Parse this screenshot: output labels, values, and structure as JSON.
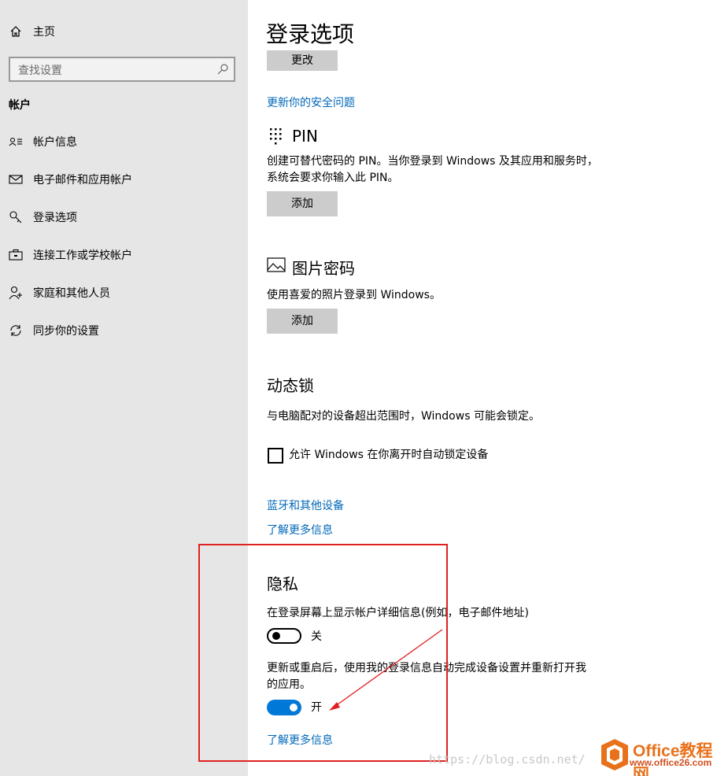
{
  "sidebar": {
    "home_label": "主页",
    "search_placeholder": "查找设置",
    "section_title": "帐户",
    "items": [
      {
        "label": "帐户信息",
        "icon": "account-info-icon"
      },
      {
        "label": "电子邮件和应用帐户",
        "icon": "mail-icon"
      },
      {
        "label": "登录选项",
        "icon": "key-icon"
      },
      {
        "label": "连接工作或学校帐户",
        "icon": "briefcase-icon"
      },
      {
        "label": "家庭和其他人员",
        "icon": "person-add-icon"
      },
      {
        "label": "同步你的设置",
        "icon": "sync-icon"
      }
    ]
  },
  "main": {
    "title": "登录选项",
    "change_button": "更改",
    "update_security_link": "更新你的安全问题",
    "pin": {
      "title": "PIN",
      "desc_line1": "创建可替代密码的 PIN。当你登录到 Windows 及其应用和服务时，",
      "desc_line2": "系统会要求你输入此 PIN。",
      "add_button": "添加"
    },
    "picture_password": {
      "title": "图片密码",
      "desc": "使用喜爱的照片登录到 Windows。",
      "add_button": "添加"
    },
    "dynamic_lock": {
      "title": "动态锁",
      "desc": "与电脑配对的设备超出范围时，Windows 可能会锁定。",
      "checkbox_label": "允许 Windows 在你离开时自动锁定设备",
      "checkbox_checked": false,
      "bluetooth_link": "蓝牙和其他设备",
      "learn_more_link": "了解更多信息"
    },
    "privacy": {
      "title": "隐私",
      "setting1_label": "在登录屏幕上显示帐户详细信息(例如，电子邮件地址)",
      "setting1_state": "关",
      "setting1_on": false,
      "setting2_line1": "更新或重启后，使用我的登录信息自动完成设备设置并重新打开我",
      "setting2_line2": "的应用。",
      "setting2_state": "开",
      "setting2_on": true,
      "learn_more_link": "了解更多信息"
    }
  },
  "overlay": {
    "watermark": "https://blog.csdn.net/",
    "logo_brand": "Office教程网",
    "logo_url": "www.office26.com",
    "annotation_color": "#e02020",
    "toggle_on_color": "#0078d7",
    "link_color": "#0067b8"
  }
}
